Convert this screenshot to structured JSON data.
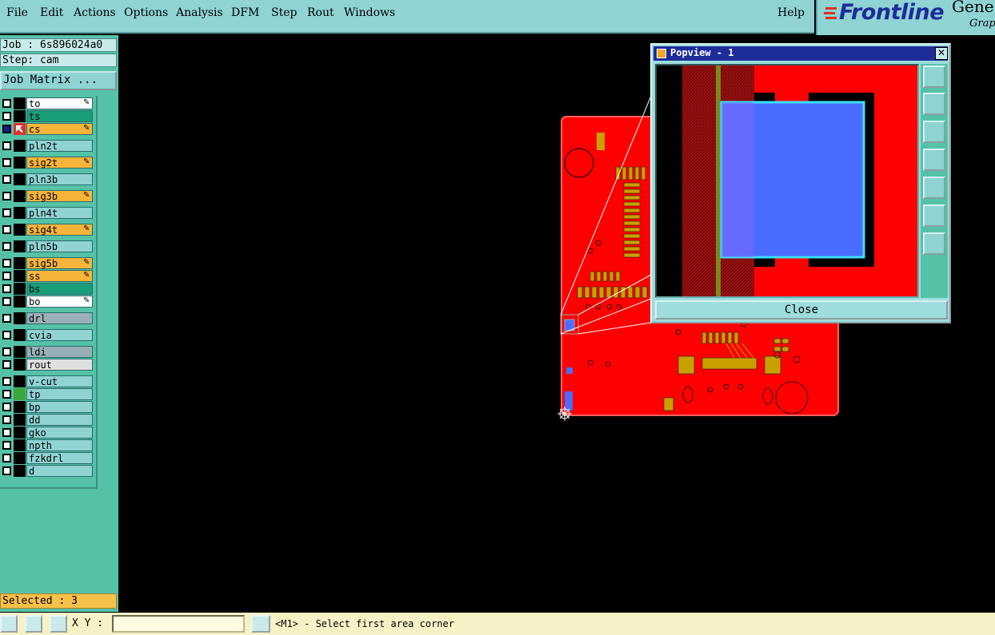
{
  "menu": {
    "items": [
      "File",
      "Edit",
      "Actions",
      "Options",
      "Analysis",
      "DFM",
      "Step",
      "Rout",
      "Windows"
    ],
    "help": "Help"
  },
  "brand": {
    "logo": "Frontline",
    "product": "Gene",
    "product_sub": "Graph"
  },
  "job": {
    "job_line": "Job : 6s896024a0",
    "step_line": "Step: cam",
    "matrix_button": "Job Matrix ..."
  },
  "layers": [
    {
      "name": "to",
      "color": "#ffffff",
      "checked": false,
      "edit": true
    },
    {
      "name": "ts",
      "color": "#1a9e7a",
      "checked": false,
      "edit": false
    },
    {
      "name": "cs",
      "color": "#f7b43a",
      "checked": true,
      "edit": true,
      "active": true
    },
    {
      "name": "pln2t",
      "color": "#8fd3d3",
      "checked": false,
      "edit": false
    },
    {
      "name": "sig2t",
      "color": "#f7b43a",
      "checked": false,
      "edit": true
    },
    {
      "name": "pln3b",
      "color": "#8fd3d3",
      "checked": false,
      "edit": false
    },
    {
      "name": "sig3b",
      "color": "#f7b43a",
      "checked": false,
      "edit": true
    },
    {
      "name": "pln4t",
      "color": "#8fd3d3",
      "checked": false,
      "edit": false
    },
    {
      "name": "sig4t",
      "color": "#f7b43a",
      "checked": false,
      "edit": true
    },
    {
      "name": "pln5b",
      "color": "#8fd3d3",
      "checked": false,
      "edit": false
    },
    {
      "name": "sig5b",
      "color": "#f7b43a",
      "checked": false,
      "edit": true
    },
    {
      "name": "ss",
      "color": "#f7b43a",
      "checked": false,
      "edit": true
    },
    {
      "name": "bs",
      "color": "#1a9e7a",
      "checked": false,
      "edit": false
    },
    {
      "name": "bo",
      "color": "#ffffff",
      "checked": false,
      "edit": true
    },
    {
      "name": "drl",
      "color": "#9ab0b8",
      "checked": false,
      "edit": false
    },
    {
      "name": "cvia",
      "color": "#8fd3d3",
      "checked": false,
      "edit": false
    },
    {
      "name": "ldi",
      "color": "#9ab0b8",
      "checked": false,
      "edit": false
    },
    {
      "name": "rout",
      "color": "#e0e0e0",
      "checked": false,
      "edit": false
    },
    {
      "name": "v-cut",
      "color": "#8fd3d3",
      "checked": false,
      "edit": false
    },
    {
      "name": "tp",
      "color": "#8fd3d3",
      "checked": false,
      "edit": false,
      "swatch": "#3aa83a"
    },
    {
      "name": "bp",
      "color": "#8fd3d3",
      "checked": false,
      "edit": false
    },
    {
      "name": "dd",
      "color": "#8fd3d3",
      "checked": false,
      "edit": false
    },
    {
      "name": "gko",
      "color": "#8fd3d3",
      "checked": false,
      "edit": false
    },
    {
      "name": "npth",
      "color": "#8fd3d3",
      "checked": false,
      "edit": false
    },
    {
      "name": "fzkdrl",
      "color": "#8fd3d3",
      "checked": false,
      "edit": false
    },
    {
      "name": "d",
      "color": "#8fd3d3",
      "checked": false,
      "edit": false
    }
  ],
  "selected": "Selected : 3",
  "status": {
    "xy_label": "X Y :",
    "xy_value": "",
    "message": "<M1> - Select first area corner"
  },
  "popview": {
    "title": "Popview - 1",
    "close_label": "Close"
  },
  "colors": {
    "board": "#ff0000",
    "pad": "#c8a000",
    "selection": "#4a6cff"
  }
}
